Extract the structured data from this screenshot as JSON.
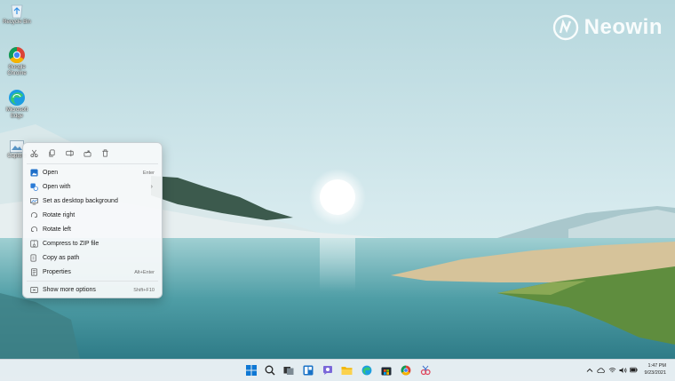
{
  "watermark": {
    "brand": "Neowin"
  },
  "desktop": {
    "icons": [
      {
        "label": "Recycle Bin",
        "icon": "recycle-bin-icon"
      },
      {
        "label": "Google Chrome",
        "icon": "chrome-icon"
      },
      {
        "label": "Microsoft Edge",
        "icon": "edge-icon"
      },
      {
        "label": "Capture",
        "icon": "image-file-icon"
      }
    ]
  },
  "context_menu": {
    "toolbar": [
      {
        "name": "cut",
        "icon": "scissors-icon"
      },
      {
        "name": "copy",
        "icon": "copy-icon"
      },
      {
        "name": "rename",
        "icon": "rename-icon"
      },
      {
        "name": "share",
        "icon": "share-icon"
      },
      {
        "name": "delete",
        "icon": "trash-icon"
      }
    ],
    "items": [
      {
        "label": "Open",
        "shortcut": "Enter"
      },
      {
        "label": "Open with",
        "submenu": "›"
      },
      {
        "label": "Set as desktop background"
      },
      {
        "label": "Rotate right"
      },
      {
        "label": "Rotate left"
      },
      {
        "label": "Compress to ZIP file"
      },
      {
        "label": "Copy as path"
      },
      {
        "label": "Properties",
        "shortcut": "Alt+Enter"
      },
      {
        "label": "Show more options",
        "shortcut": "Shift+F10"
      }
    ]
  },
  "taskbar": {
    "apps": [
      "start-icon",
      "search-icon",
      "task-view-icon",
      "widgets-icon",
      "teams-chat-icon",
      "file-explorer-icon",
      "edge-icon",
      "store-icon",
      "chrome-icon",
      "snipping-tool-icon"
    ],
    "tray_icons": [
      "chevron-up-icon",
      "onedrive-icon",
      "wifi-icon",
      "volume-icon",
      "battery-icon"
    ],
    "time": "1:47 PM",
    "date": "9/23/2021"
  },
  "colors": {
    "accent": "#0067c0",
    "menu_bg": "#f6f9fa",
    "taskbar_bg": "#e4ecf0"
  }
}
